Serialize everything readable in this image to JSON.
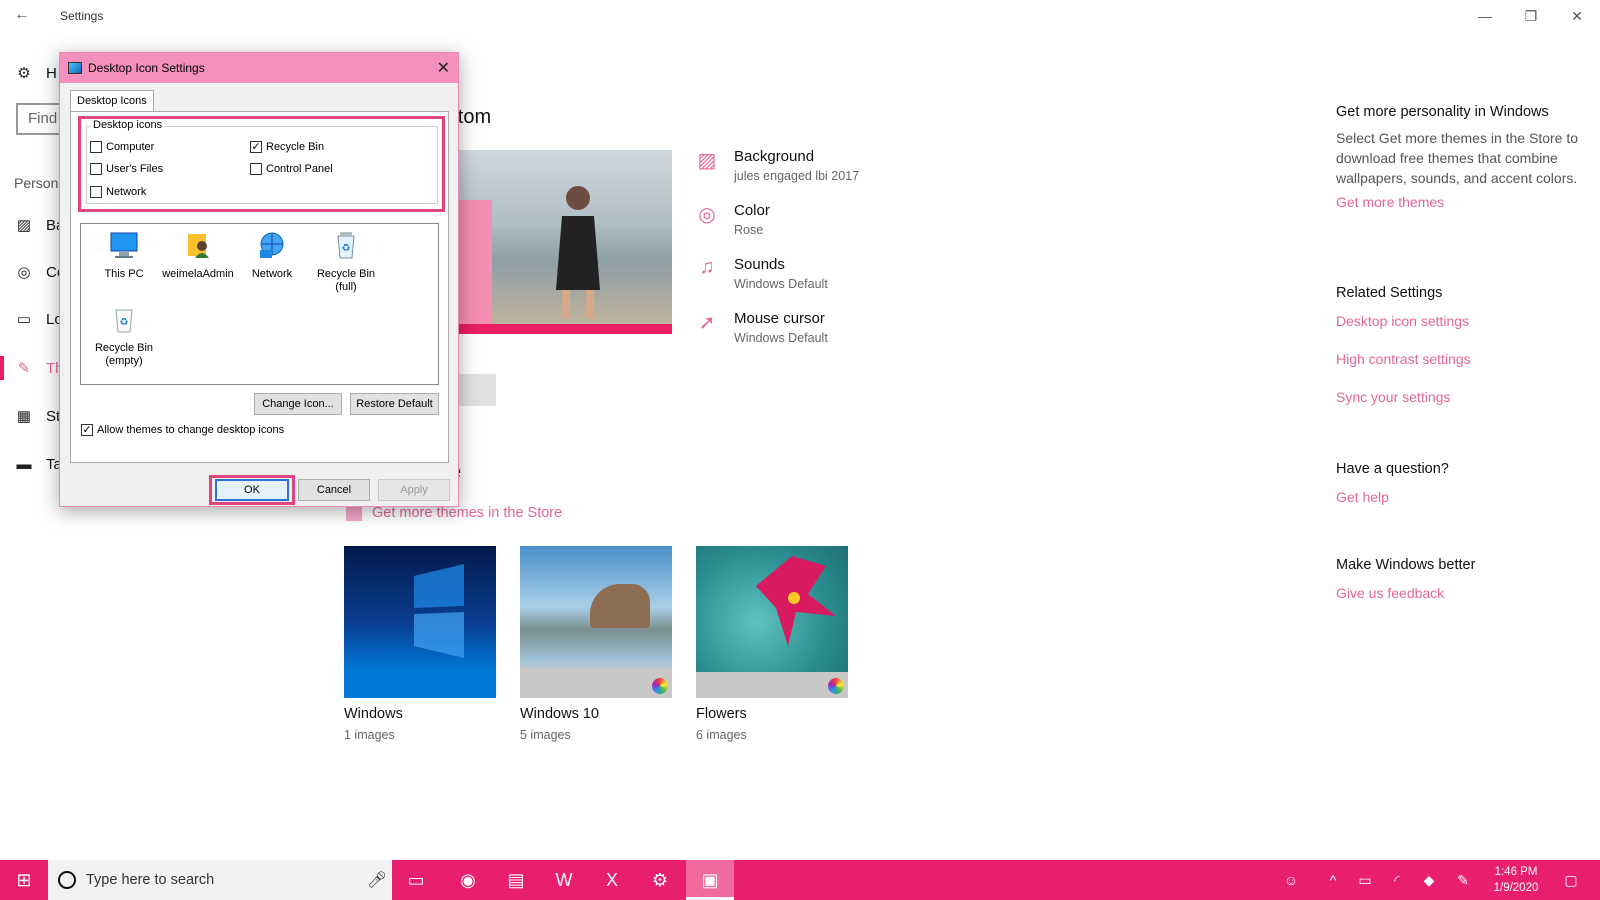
{
  "window": {
    "title": "Settings",
    "controls": {
      "minimize": "—",
      "restore": "❐",
      "close": "✕"
    }
  },
  "nav": {
    "home_partial": "H",
    "find_placeholder": "Find",
    "section_partial": "Person",
    "items": [
      {
        "partial": "Ba",
        "icon": "picture-icon"
      },
      {
        "partial": "Co",
        "icon": "palette-icon"
      },
      {
        "partial": "Lo",
        "icon": "lock-screen-icon"
      },
      {
        "partial": "Th",
        "icon": "themes-icon",
        "active": true
      },
      {
        "partial": "St",
        "icon": "start-icon"
      },
      {
        "partial": "Ta",
        "icon": "taskbar-icon"
      }
    ]
  },
  "main": {
    "theme_heading_partial": "e: Custom",
    "properties": [
      {
        "title": "Background",
        "sub": "jules engaged lbi 2017",
        "icon": "picture-icon"
      },
      {
        "title": "Color",
        "sub": "Rose",
        "icon": "palette-icon"
      },
      {
        "title": "Sounds",
        "sub": "Windows Default",
        "icon": "speaker-icon"
      },
      {
        "title": "Mouse cursor",
        "sub": "Windows Default",
        "icon": "cursor-icon"
      }
    ],
    "apply_heading_partial": "e",
    "store_link": "Get more themes in the Store",
    "themes": [
      {
        "name": "Windows",
        "count": "1 images"
      },
      {
        "name": "Windows 10",
        "count": "5 images"
      },
      {
        "name": "Flowers",
        "count": "6 images"
      }
    ]
  },
  "right": {
    "personality": {
      "heading": "Get more personality in Windows",
      "text": "Select Get more themes in the Store to download free themes that combine wallpapers, sounds, and accent colors.",
      "link": "Get more themes"
    },
    "related": {
      "heading": "Related Settings",
      "links": [
        "Desktop icon settings",
        "High contrast settings",
        "Sync your settings"
      ]
    },
    "question": {
      "heading": "Have a question?",
      "link": "Get help"
    },
    "better": {
      "heading": "Make Windows better",
      "link": "Give us feedback"
    }
  },
  "dialog": {
    "title": "Desktop Icon Settings",
    "tab": "Desktop Icons",
    "group_label": "Desktop icons",
    "checkboxes": [
      {
        "label": "Computer",
        "checked": false
      },
      {
        "label": "Recycle Bin",
        "checked": true
      },
      {
        "label": "User's Files",
        "checked": false
      },
      {
        "label": "Control Panel",
        "checked": false
      },
      {
        "label": "Network",
        "checked": false
      }
    ],
    "icons": [
      {
        "label": "This PC"
      },
      {
        "label": "weimelaAdmin"
      },
      {
        "label": "Network"
      },
      {
        "label": "Recycle Bin\n(full)"
      },
      {
        "label": "Recycle Bin\n(empty)"
      }
    ],
    "change_icon": "Change Icon...",
    "restore_default": "Restore Default",
    "allow_themes": {
      "label": "Allow themes to change desktop icons",
      "checked": true
    },
    "ok": "OK",
    "cancel": "Cancel",
    "apply": "Apply",
    "check_glyph": "✓"
  },
  "taskbar": {
    "search_placeholder": "Type here to search",
    "time": "1:46 PM",
    "date": "1/9/2020"
  },
  "colors": {
    "accent": "#e81e6e",
    "link": "#e2669b",
    "dialog_title": "#f390bd",
    "highlight": "#e0457f"
  }
}
